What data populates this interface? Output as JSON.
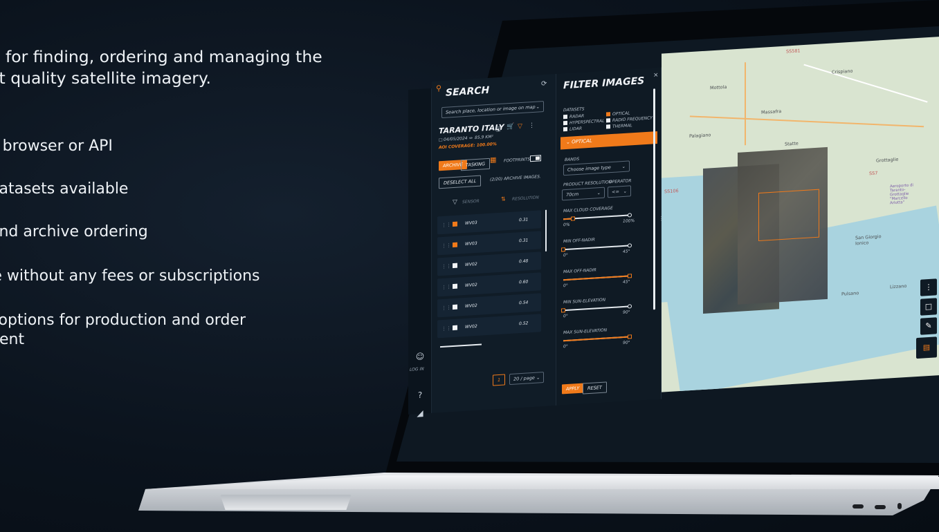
{
  "headline": "l tool for finding, ordering and managing the\nghest quality satellite imagery.",
  "features": [
    "via browser or API",
    "e datasets available",
    "g and archive ordering",
    "use without any fees or subscriptions",
    "ve options for production and order",
    "ement"
  ],
  "app": {
    "search": {
      "title": "SEARCH",
      "placeholder": "Search place, location or image on map",
      "place_name": "TARANTO ITALY",
      "date": "04/05/2024",
      "area": "85,9 KM²",
      "aoi_coverage": "AOI COVERAGE: 100.00%",
      "tab_archive": "ARCHIVE",
      "tab_tasking": "TASKING",
      "footprints_label": "FOOTPRINTS",
      "deselect_all": "DESELECT ALL",
      "archive_count": "(2/20) ARCHIVE IMAGES.",
      "col_sensor": "SENSOR",
      "col_resolution": "RESOLUTION",
      "rows": [
        {
          "sensor": "WV03",
          "resolution": "0.31",
          "checked": true
        },
        {
          "sensor": "WV03",
          "resolution": "0.31",
          "checked": true
        },
        {
          "sensor": "WV02",
          "resolution": "0.48",
          "checked": false
        },
        {
          "sensor": "WV02",
          "resolution": "0.60",
          "checked": false
        },
        {
          "sensor": "WV02",
          "resolution": "0.54",
          "checked": false
        },
        {
          "sensor": "WV02",
          "resolution": "0.52",
          "checked": false
        }
      ],
      "page_number": "1",
      "per_page": "20 / page"
    },
    "rail": {
      "login_label": "LOG IN"
    },
    "filter": {
      "title": "FILTER IMAGES",
      "datasets_label": "DATASETS",
      "datasets": [
        {
          "label": "RADAR",
          "checked": false
        },
        {
          "label": "OPTICAL",
          "checked": true
        },
        {
          "label": "HYPERSPECTRAL",
          "checked": false
        },
        {
          "label": "RADIO FREQUENCY",
          "checked": false
        },
        {
          "label": "LIDAR",
          "checked": false
        },
        {
          "label": "THERMAL",
          "checked": false
        }
      ],
      "section": "OPTICAL",
      "bands_label": "BANDS",
      "bands_placeholder": "Choose image type",
      "product_resolution_label": "PRODUCT RESOLUTION",
      "operator_label": "OPERATOR",
      "resolution_value": "70cm",
      "operator_value": "<=",
      "sliders": [
        {
          "label": "MAX CLOUD COVERAGE",
          "min": "0%",
          "max": "100%",
          "value": 0.15
        },
        {
          "label": "MIN OFF-NADIR",
          "min": "0°",
          "max": "45°",
          "value": 0.0
        },
        {
          "label": "MAX OFF-NADIR",
          "min": "0°",
          "max": "45°",
          "value": 1.0
        },
        {
          "label": "MIN SUN-ELEVATION",
          "min": "0°",
          "max": "90°",
          "value": 0.0
        },
        {
          "label": "MAX SUN-ELEVATION",
          "min": "0°",
          "max": "90°",
          "value": 1.0
        }
      ],
      "apply": "APPLY",
      "reset": "RESET"
    },
    "map": {
      "places": [
        "SS581",
        "Mottola",
        "Crispiano",
        "Massafra",
        "Palagiano",
        "Statte",
        "Grottaglie",
        "SS7",
        "San Giorgio Ionico",
        "Pulsano",
        "Lizzano",
        "SS106"
      ],
      "airport_label": "Aeroporto di Taranto-Grottaglie \"Marcello Arlotta\""
    }
  },
  "colors": {
    "accent": "#f07a1a",
    "panel": "#101c27",
    "background": "#0b131d"
  }
}
